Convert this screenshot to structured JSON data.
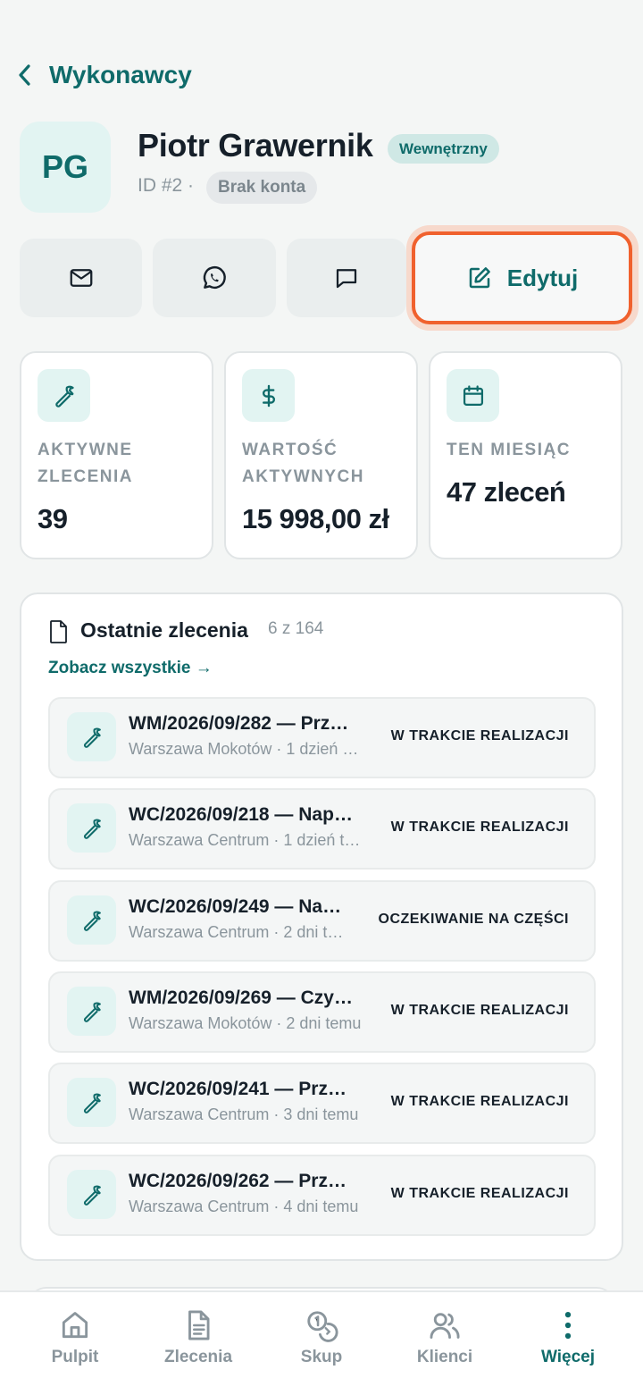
{
  "header": {
    "title": "Wykonawcy"
  },
  "profile": {
    "initials": "PG",
    "name": "Piotr Grawernik",
    "type_badge": "Wewnętrzny",
    "id_text": "ID #2 ·",
    "account_badge": "Brak konta"
  },
  "actions": {
    "email_icon": "mail-icon",
    "whatsapp_icon": "whatsapp-icon",
    "message_icon": "chat-icon",
    "edit_label": "Edytuj"
  },
  "stats": [
    {
      "icon": "wrench-icon",
      "label": "AKTYWNE ZLECENIA",
      "value": "39"
    },
    {
      "icon": "dollar-icon",
      "label": "WARTOŚĆ AKTYWNYCH",
      "value": "15 998,00 zł"
    },
    {
      "icon": "calendar-icon",
      "label": "TEN MIESIĄC",
      "value": "47 zleceń"
    }
  ],
  "recent": {
    "title": "Ostatnie zlecenia",
    "count": "6 z 164",
    "see_all": "Zobacz wszystkie →",
    "orders": [
      {
        "title": "WM/2026/09/282 — Prz…",
        "subtitle": "Warszawa Mokotów · 1 dzień …",
        "status": "W TRAKCIE REALIZACJI"
      },
      {
        "title": "WC/2026/09/218 — Nap…",
        "subtitle": "Warszawa Centrum · 1 dzień t…",
        "status": "W TRAKCIE REALIZACJI"
      },
      {
        "title": "WC/2026/09/249 — Na…",
        "subtitle": "Warszawa Centrum · 2 dni t…",
        "status": "OCZEKIWANIE NA CZĘŚCI"
      },
      {
        "title": "WM/2026/09/269 — Czy…",
        "subtitle": "Warszawa Mokotów · 2 dni temu",
        "status": "W TRAKCIE REALIZACJI"
      },
      {
        "title": "WC/2026/09/241 — Prz…",
        "subtitle": "Warszawa Centrum · 3 dni temu",
        "status": "W TRAKCIE REALIZACJI"
      },
      {
        "title": "WC/2026/09/262 — Prz…",
        "subtitle": "Warszawa Centrum · 4 dni temu",
        "status": "W TRAKCIE REALIZACJI"
      }
    ]
  },
  "nav": [
    {
      "icon": "home-icon",
      "label": "Pulpit"
    },
    {
      "icon": "document-icon",
      "label": "Zlecenia"
    },
    {
      "icon": "coins-icon",
      "label": "Skup"
    },
    {
      "icon": "users-icon",
      "label": "Klienci"
    },
    {
      "icon": "more-vertical-icon",
      "label": "Więcej",
      "active": true
    }
  ],
  "colors": {
    "accent": "#0f6b6a",
    "highlight": "#f0612e",
    "muted": "#8a959c"
  }
}
